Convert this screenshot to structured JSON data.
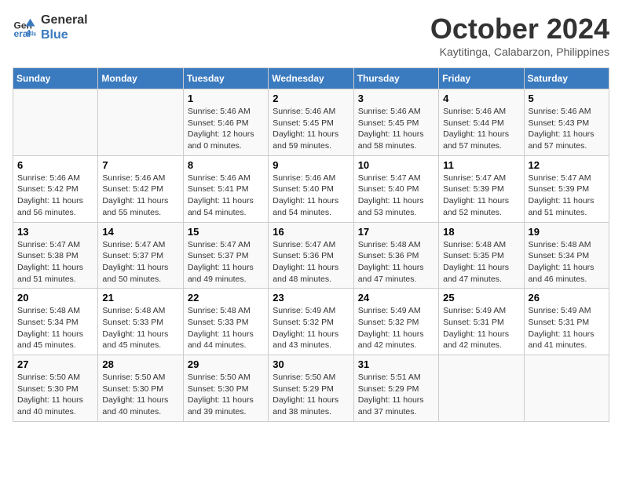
{
  "header": {
    "logo_line1": "General",
    "logo_line2": "Blue",
    "month_title": "October 2024",
    "subtitle": "Kaytitinga, Calabarzon, Philippines"
  },
  "days_of_week": [
    "Sunday",
    "Monday",
    "Tuesday",
    "Wednesday",
    "Thursday",
    "Friday",
    "Saturday"
  ],
  "weeks": [
    [
      {
        "day": "",
        "content": ""
      },
      {
        "day": "",
        "content": ""
      },
      {
        "day": "1",
        "content": "Sunrise: 5:46 AM\nSunset: 5:46 PM\nDaylight: 12 hours\nand 0 minutes."
      },
      {
        "day": "2",
        "content": "Sunrise: 5:46 AM\nSunset: 5:45 PM\nDaylight: 11 hours\nand 59 minutes."
      },
      {
        "day": "3",
        "content": "Sunrise: 5:46 AM\nSunset: 5:45 PM\nDaylight: 11 hours\nand 58 minutes."
      },
      {
        "day": "4",
        "content": "Sunrise: 5:46 AM\nSunset: 5:44 PM\nDaylight: 11 hours\nand 57 minutes."
      },
      {
        "day": "5",
        "content": "Sunrise: 5:46 AM\nSunset: 5:43 PM\nDaylight: 11 hours\nand 57 minutes."
      }
    ],
    [
      {
        "day": "6",
        "content": "Sunrise: 5:46 AM\nSunset: 5:42 PM\nDaylight: 11 hours\nand 56 minutes."
      },
      {
        "day": "7",
        "content": "Sunrise: 5:46 AM\nSunset: 5:42 PM\nDaylight: 11 hours\nand 55 minutes."
      },
      {
        "day": "8",
        "content": "Sunrise: 5:46 AM\nSunset: 5:41 PM\nDaylight: 11 hours\nand 54 minutes."
      },
      {
        "day": "9",
        "content": "Sunrise: 5:46 AM\nSunset: 5:40 PM\nDaylight: 11 hours\nand 54 minutes."
      },
      {
        "day": "10",
        "content": "Sunrise: 5:47 AM\nSunset: 5:40 PM\nDaylight: 11 hours\nand 53 minutes."
      },
      {
        "day": "11",
        "content": "Sunrise: 5:47 AM\nSunset: 5:39 PM\nDaylight: 11 hours\nand 52 minutes."
      },
      {
        "day": "12",
        "content": "Sunrise: 5:47 AM\nSunset: 5:39 PM\nDaylight: 11 hours\nand 51 minutes."
      }
    ],
    [
      {
        "day": "13",
        "content": "Sunrise: 5:47 AM\nSunset: 5:38 PM\nDaylight: 11 hours\nand 51 minutes."
      },
      {
        "day": "14",
        "content": "Sunrise: 5:47 AM\nSunset: 5:37 PM\nDaylight: 11 hours\nand 50 minutes."
      },
      {
        "day": "15",
        "content": "Sunrise: 5:47 AM\nSunset: 5:37 PM\nDaylight: 11 hours\nand 49 minutes."
      },
      {
        "day": "16",
        "content": "Sunrise: 5:47 AM\nSunset: 5:36 PM\nDaylight: 11 hours\nand 48 minutes."
      },
      {
        "day": "17",
        "content": "Sunrise: 5:48 AM\nSunset: 5:36 PM\nDaylight: 11 hours\nand 47 minutes."
      },
      {
        "day": "18",
        "content": "Sunrise: 5:48 AM\nSunset: 5:35 PM\nDaylight: 11 hours\nand 47 minutes."
      },
      {
        "day": "19",
        "content": "Sunrise: 5:48 AM\nSunset: 5:34 PM\nDaylight: 11 hours\nand 46 minutes."
      }
    ],
    [
      {
        "day": "20",
        "content": "Sunrise: 5:48 AM\nSunset: 5:34 PM\nDaylight: 11 hours\nand 45 minutes."
      },
      {
        "day": "21",
        "content": "Sunrise: 5:48 AM\nSunset: 5:33 PM\nDaylight: 11 hours\nand 45 minutes."
      },
      {
        "day": "22",
        "content": "Sunrise: 5:48 AM\nSunset: 5:33 PM\nDaylight: 11 hours\nand 44 minutes."
      },
      {
        "day": "23",
        "content": "Sunrise: 5:49 AM\nSunset: 5:32 PM\nDaylight: 11 hours\nand 43 minutes."
      },
      {
        "day": "24",
        "content": "Sunrise: 5:49 AM\nSunset: 5:32 PM\nDaylight: 11 hours\nand 42 minutes."
      },
      {
        "day": "25",
        "content": "Sunrise: 5:49 AM\nSunset: 5:31 PM\nDaylight: 11 hours\nand 42 minutes."
      },
      {
        "day": "26",
        "content": "Sunrise: 5:49 AM\nSunset: 5:31 PM\nDaylight: 11 hours\nand 41 minutes."
      }
    ],
    [
      {
        "day": "27",
        "content": "Sunrise: 5:50 AM\nSunset: 5:30 PM\nDaylight: 11 hours\nand 40 minutes."
      },
      {
        "day": "28",
        "content": "Sunrise: 5:50 AM\nSunset: 5:30 PM\nDaylight: 11 hours\nand 40 minutes."
      },
      {
        "day": "29",
        "content": "Sunrise: 5:50 AM\nSunset: 5:30 PM\nDaylight: 11 hours\nand 39 minutes."
      },
      {
        "day": "30",
        "content": "Sunrise: 5:50 AM\nSunset: 5:29 PM\nDaylight: 11 hours\nand 38 minutes."
      },
      {
        "day": "31",
        "content": "Sunrise: 5:51 AM\nSunset: 5:29 PM\nDaylight: 11 hours\nand 37 minutes."
      },
      {
        "day": "",
        "content": ""
      },
      {
        "day": "",
        "content": ""
      }
    ]
  ]
}
